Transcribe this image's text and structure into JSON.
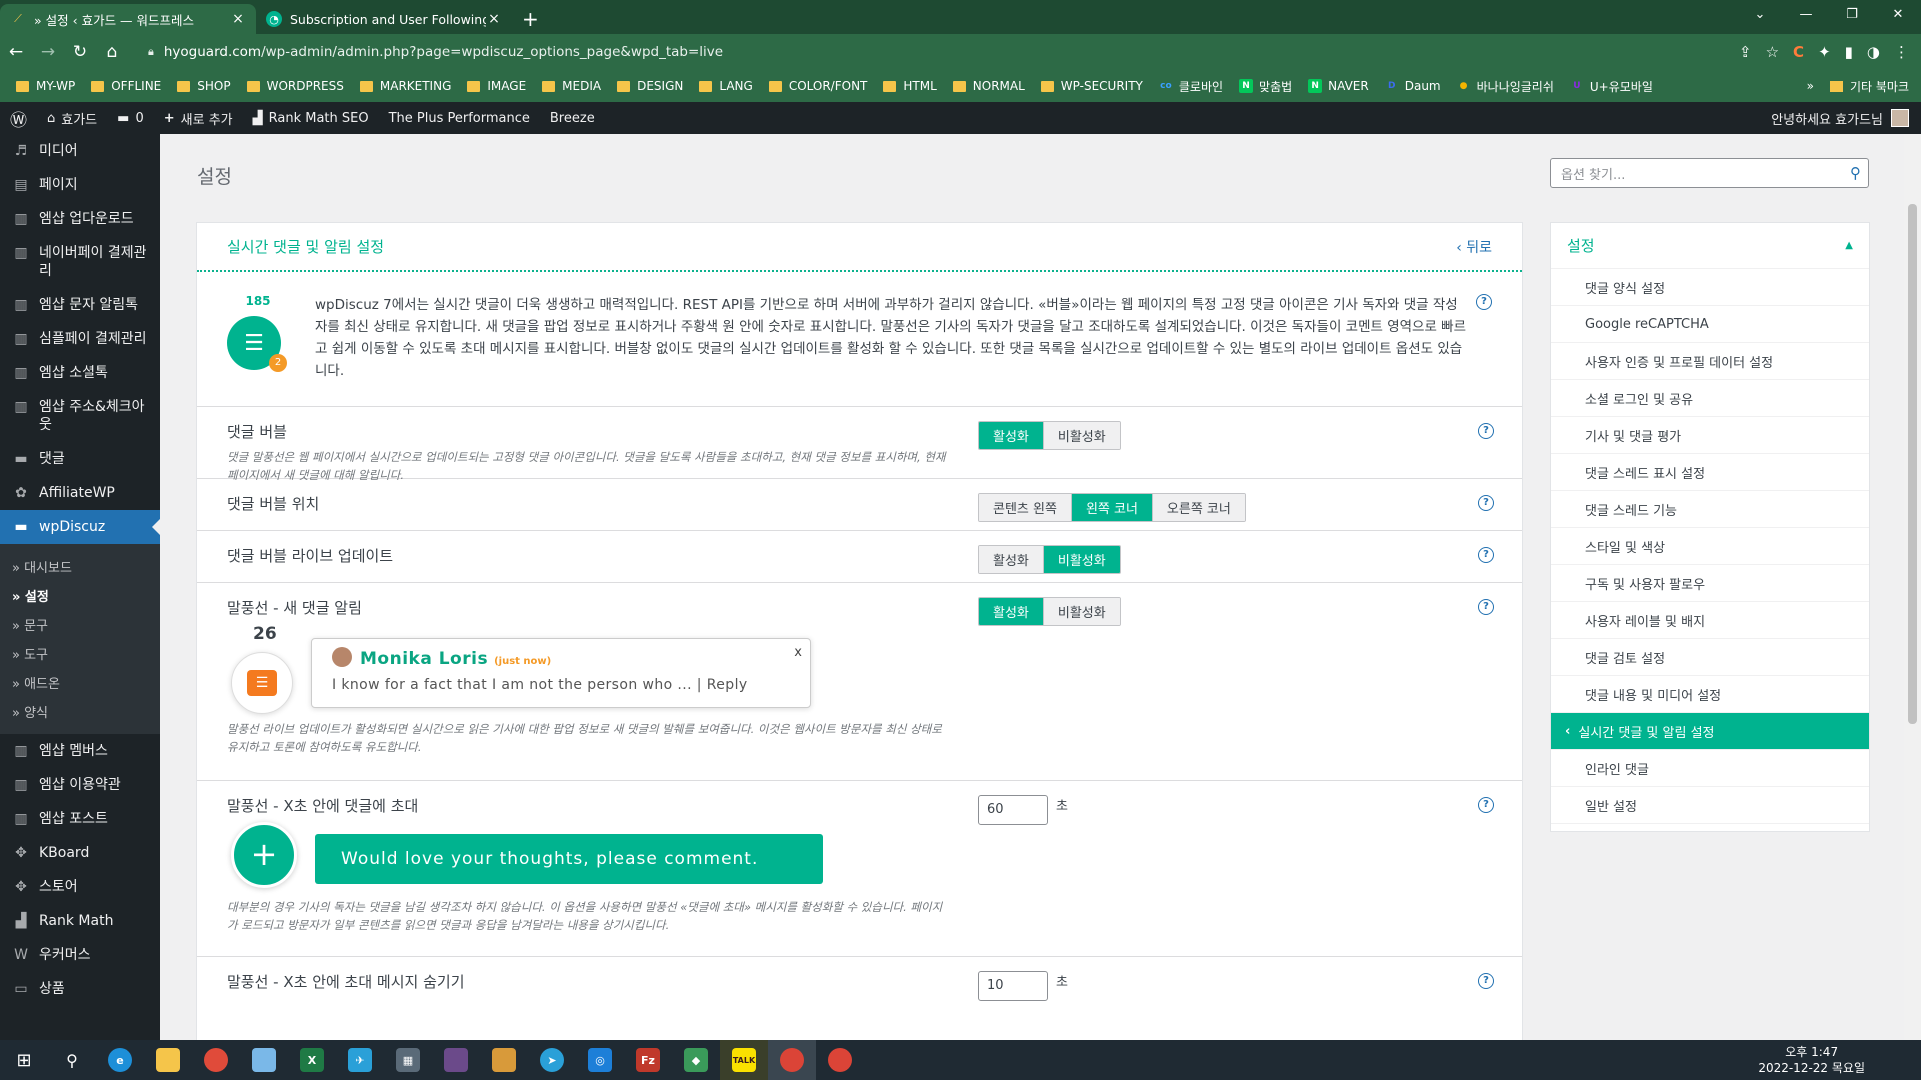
{
  "browser": {
    "tabs": [
      {
        "title": "» 설정 ‹ 효가드 — 워드프레스",
        "active": true
      },
      {
        "title": "Subscription and User Following",
        "active": false
      }
    ],
    "new_tab": "+",
    "url_host": "hyoguard.com",
    "url_path": "/wp-admin/admin.php?page=wpdiscuz_options_page&wpd_tab=live",
    "bookmarks": [
      {
        "label": "MY-WP",
        "type": "folder"
      },
      {
        "label": "OFFLINE",
        "type": "folder"
      },
      {
        "label": "SHOP",
        "type": "folder"
      },
      {
        "label": "WORDPRESS",
        "type": "folder"
      },
      {
        "label": "MARKETING",
        "type": "folder"
      },
      {
        "label": "IMAGE",
        "type": "folder"
      },
      {
        "label": "MEDIA",
        "type": "folder"
      },
      {
        "label": "DESIGN",
        "type": "folder"
      },
      {
        "label": "LANG",
        "type": "folder"
      },
      {
        "label": "COLOR/FONT",
        "type": "folder"
      },
      {
        "label": "HTML",
        "type": "folder"
      },
      {
        "label": "NORMAL",
        "type": "folder"
      },
      {
        "label": "WP-SECURITY",
        "type": "folder"
      },
      {
        "label": "클로바인",
        "type": "site",
        "icon": "co",
        "color": "#3aa0ff"
      },
      {
        "label": "맞춤법",
        "type": "site",
        "icon": "N",
        "color": "#03c75a"
      },
      {
        "label": "NAVER",
        "type": "site",
        "icon": "N",
        "color": "#03c75a"
      },
      {
        "label": "Daum",
        "type": "site",
        "icon": "D",
        "color": "#3c6cf0"
      },
      {
        "label": "바나나잉글리쉬",
        "type": "site",
        "icon": "●",
        "color": "#f4b400"
      },
      {
        "label": "U+유모바일",
        "type": "site",
        "icon": "U",
        "color": "#8a2be2"
      }
    ],
    "bookmarks_more": "»",
    "other_bookmarks": "기타 북마크"
  },
  "adminbar": {
    "site_name": "효가드",
    "comments_count": "0",
    "new_label": "새로 추가",
    "items": [
      "Rank Math SEO",
      "The Plus Performance",
      "Breeze"
    ],
    "greeting": "안녕하세요 효가드님"
  },
  "sidebar": {
    "items_top": [
      {
        "label": "미디어",
        "icon": "media-icon"
      },
      {
        "label": "페이지",
        "icon": "page-icon"
      },
      {
        "label": "엠샵 업다운로드",
        "icon": "shop-icon"
      },
      {
        "label": "네이버페이 결제관리",
        "icon": "shop-icon"
      },
      {
        "label": "엠샵 문자 알림톡",
        "icon": "shop-icon"
      },
      {
        "label": "심플페이 결제관리",
        "icon": "shop-icon"
      },
      {
        "label": "엠샵 소셜톡",
        "icon": "shop-icon"
      },
      {
        "label": "엠샵 주소&체크아웃",
        "icon": "shop-icon"
      },
      {
        "label": "댓글",
        "icon": "comment-icon"
      },
      {
        "label": "AffiliateWP",
        "icon": "affiliate-icon"
      }
    ],
    "current": "wpDiscuz",
    "submenu": [
      "» 대시보드",
      "» 설정",
      "» 문구",
      "» 도구",
      "» 애드온",
      "» 양식"
    ],
    "submenu_current_index": 1,
    "items_bottom": [
      {
        "label": "엠샵 멤버스",
        "icon": "shop-icon"
      },
      {
        "label": "엠샵 이용약관",
        "icon": "shop-icon"
      },
      {
        "label": "엠샵 포스트",
        "icon": "shop-icon"
      },
      {
        "label": "KBoard",
        "icon": "kboard-icon"
      },
      {
        "label": "스토어",
        "icon": "kboard-icon"
      },
      {
        "label": "Rank Math",
        "icon": "rankmath-icon"
      },
      {
        "label": "우커머스",
        "icon": "woo-icon"
      },
      {
        "label": "상품",
        "icon": "product-icon"
      }
    ]
  },
  "page": {
    "title": "설정",
    "search_placeholder": "옵션 찾기..."
  },
  "panel": {
    "title": "실시간 댓글 및 알림 설정",
    "back": "‹ 뒤로",
    "intro_count": "185",
    "intro_badge": "2",
    "intro_text": "wpDiscuz 7에서는 실시간 댓글이 더욱 생생하고 매력적입니다. REST API를 기반으로 하며 서버에 과부하가 걸리지 않습니다. «버블»이라는 웹 페이지의 특정 고정 댓글 아이콘은 기사 독자와 댓글 작성자를 최신 상태로 유지합니다. 새 댓글을 팝업 정보로 표시하거나 주황색 원 안에 숫자로 표시합니다. 말풍선은 기사의 독자가 댓글을 달고 조대하도록 설계되었습니다. 이것은 독자들이 코멘트 영역으로 빠르고 쉽게 이동할 수 있도록 초대 메시지를 표시합니다. 버블창 없이도 댓글의 실시간 업데이트를 활성화 할 수 있습니다. 또한 댓글 목록을 실시간으로 업데이트할 수 있는 별도의 라이브 업데이트 옵션도 있습니다.",
    "rows": {
      "bubble": {
        "label": "댓글 버블",
        "desc": "댓글 말풍선은 웹 페이지에서 실시간으로 업데이트되는 고정형 댓글 아이콘입니다. 댓글을 달도록 사람들을 초대하고, 현재 댓글 정보를 표시하며, 현재 페이지에서 새 댓글에 대해 알립니다.",
        "options": [
          "활성화",
          "비활성화"
        ],
        "selected": 0
      },
      "position": {
        "label": "댓글 버블 위치",
        "options": [
          "콘텐츠 왼쪽",
          "왼쪽 코너",
          "오른쪽 코너"
        ],
        "selected": 1
      },
      "live": {
        "label": "댓글 버블 라이브 업데이트",
        "options": [
          "활성화",
          "비활성화"
        ],
        "selected": 1
      },
      "notify": {
        "label": "말풍선 - 새 댓글 알림",
        "options": [
          "활성화",
          "비활성화"
        ],
        "selected": 0,
        "demo_count": "26",
        "demo_name": "Monika Loris",
        "demo_time": "(just now)",
        "demo_msg": "I know for a fact that I am not the person who ... | Reply",
        "demo_close": "x",
        "desc": "말풍선 라이브 업데이트가 활성화되면 실시간으로 읽은 기사에 대한 팝업 정보로 새 댓글의 발췌를 보여줍니다. 이것은 웹사이트 방문자를 최신 상태로 유지하고 토론에 참여하도록 유도합니다."
      },
      "invite": {
        "label": "말풍선 - X초 안에 댓글에 초대",
        "value": "60",
        "unit": "초",
        "demo_text": "Would love your thoughts, please comment.",
        "desc": "대부분의 경우 기사의 독자는 댓글을 남길 생각조차 하지 않습니다. 이 옵션을 사용하면 말풍선 «댓글에 초대» 메시지를 활성화할 수 있습니다. 페이지가 로드되고 방문자가 일부 콘텐츠를 읽으면 댓글과 응답을 남겨달라는 내용을 상기시킵니다."
      },
      "hide": {
        "label": "말풍선 - X초 안에 초대 메시지 숨기기",
        "value": "10",
        "unit": "초"
      }
    }
  },
  "right_panel": {
    "title": "설정",
    "items": [
      "댓글 양식 설정",
      "Google reCAPTCHA",
      "사용자 인증 및 프로필 데이터 설정",
      "소셜 로그인 및 공유",
      "기사 및 댓글 평가",
      "댓글 스레드 표시 설정",
      "댓글 스레드 기능",
      "스타일 및 색상",
      "구독 및 사용자 팔로우",
      "사용자 레이블 및 배지",
      "댓글 검토 설정",
      "댓글 내용 및 미디어 설정",
      "실시간 댓글 및 알림 설정",
      "인라인 댓글",
      "일반 설정"
    ],
    "current_index": 12
  },
  "taskbar": {
    "time": "오후 1:47",
    "date": "2022-12-22 목요일"
  },
  "colors": {
    "accent": "#00b38f",
    "wp_blue": "#2271b1",
    "admin_dark": "#1d2327",
    "chrome_green": "#2d6a46"
  }
}
